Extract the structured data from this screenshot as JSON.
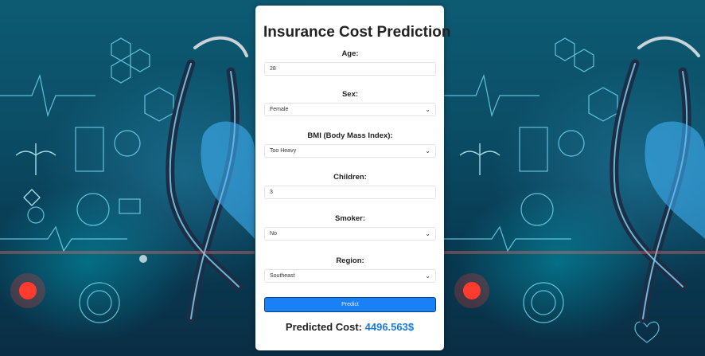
{
  "page": {
    "title": "Insurance Cost Prediction"
  },
  "form": {
    "age": {
      "label": "Age:",
      "value": "28"
    },
    "sex": {
      "label": "Sex:",
      "value": "Female"
    },
    "bmi": {
      "label": "BMI (Body Mass Index):",
      "value": "Too Heavy"
    },
    "children": {
      "label": "Children:",
      "value": "3"
    },
    "smoker": {
      "label": "Smoker:",
      "value": "No"
    },
    "region": {
      "label": "Region:",
      "value": "Southeast"
    },
    "predict_label": "Predict"
  },
  "result": {
    "label": "Predicted Cost:",
    "value": "4496.563$"
  },
  "colors": {
    "button": "#1a80f5",
    "result_value": "#1a7be0",
    "card": "#ffffff"
  },
  "icons": {
    "select_chevron": "chevron-down-icon",
    "background": "medical-stethoscope-heart-illustration"
  }
}
